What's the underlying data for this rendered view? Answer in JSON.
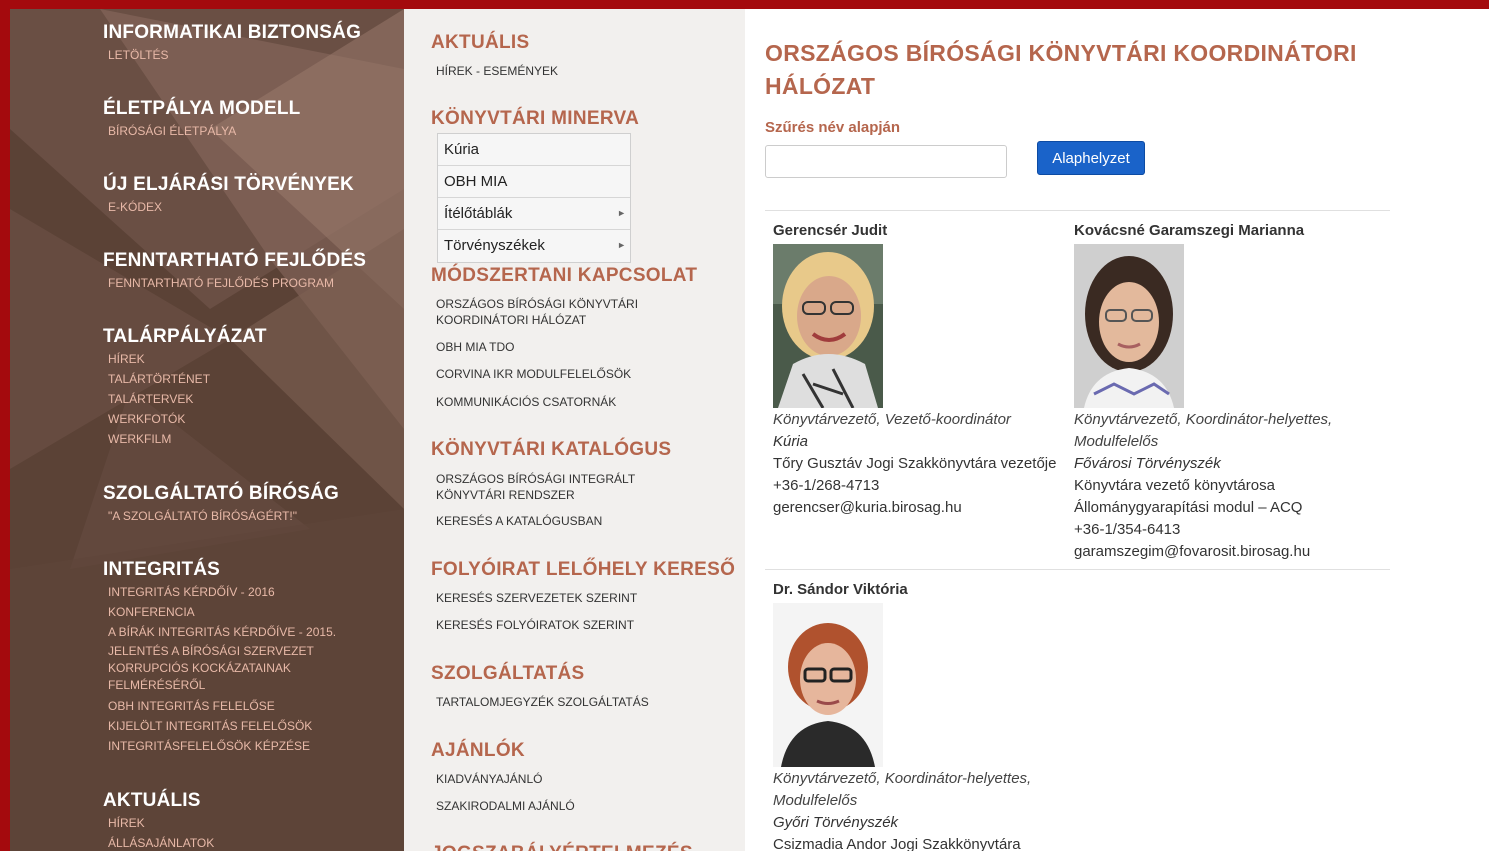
{
  "left_sidebar": {
    "sections": [
      {
        "title": "INFORMATIKAI BIZTONSÁG",
        "links": [
          "LETÖLTÉS"
        ]
      },
      {
        "title": "ÉLETPÁLYA MODELL",
        "links": [
          "BÍRÓSÁGI ÉLETPÁLYA"
        ]
      },
      {
        "title": "ÚJ ELJÁRÁSI TÖRVÉNYEK",
        "links": [
          "E-KÓDEX"
        ]
      },
      {
        "title": "FENNTARTHATÓ FEJLŐDÉS",
        "links": [
          "FENNTARTHATÓ FEJLŐDÉS PROGRAM"
        ]
      },
      {
        "title": "TALÁRPÁLYÁZAT",
        "links": [
          "HÍREK",
          "TALÁRTÖRTÉNET",
          "TALÁRTERVEK",
          "WERKFOTÓK",
          "WERKFILM"
        ]
      },
      {
        "title": "SZOLGÁLTATÓ BÍRÓSÁG",
        "links": [
          "\"A SZOLGÁLTATÓ BÍRÓSÁGÉRT!\""
        ]
      },
      {
        "title": "INTEGRITÁS",
        "links": [
          "INTEGRITÁS KÉRDŐÍV - 2016",
          "KONFERENCIA",
          "A BÍRÁK INTEGRITÁS KÉRDŐÍVE - 2015.",
          "JELENTÉS A BÍRÓSÁGI SZERVEZET KORRUPCIÓS KOCKÁZATAINAK FELMÉRÉSÉRŐL",
          "OBH INTEGRITÁS FELELŐSE",
          "KIJELÖLT INTEGRITÁS FELELŐSÖK",
          "INTEGRITÁSFELELŐSÖK KÉPZÉSE"
        ]
      },
      {
        "title": "AKTUÁLIS",
        "links": [
          "HÍREK",
          "ÁLLÁSAJÁNLATOK"
        ]
      }
    ]
  },
  "middle": {
    "aktualis": {
      "heading": "AKTUÁLIS",
      "links": [
        "HÍREK - ESEMÉNYEK"
      ]
    },
    "minerva": {
      "heading": "KÖNYVTÁRI MINERVA",
      "menu": [
        "Kúria",
        "OBH MIA",
        "Ítélőtáblák",
        "Törvényszékek"
      ],
      "arrow": "►"
    },
    "modszertani": {
      "heading": "MÓDSZERTANI KAPCSOLAT",
      "links": [
        "ORSZÁGOS BÍRÓSÁGI KÖNYVTÁRI KOORDINÁTORI HÁLÓZAT",
        "OBH MIA TDO",
        "CORVINA IKR MODULFELELŐSÖK",
        "KOMMUNIKÁCIÓS CSATORNÁK"
      ]
    },
    "katalogus": {
      "heading": "KÖNYVTÁRI KATALÓGUS",
      "links": [
        "ORSZÁGOS BÍRÓSÁGI INTEGRÁLT KÖNYVTÁRI RENDSZER",
        "KERESÉS A KATALÓGUSBAN"
      ]
    },
    "folyoirat": {
      "heading": "FOLYÓIRAT LELŐHELY KERESŐ",
      "links": [
        "KERESÉS SZERVEZETEK SZERINT",
        "KERESÉS FOLYÓIRATOK SZERINT"
      ]
    },
    "szolgaltatas": {
      "heading": "SZOLGÁLTATÁS",
      "links": [
        "TARTALOMJEGYZÉK SZOLGÁLTATÁS"
      ]
    },
    "ajanlok": {
      "heading": "AJÁNLÓK",
      "links": [
        "KIADVÁNYAJÁNLÓ",
        "SZAKIRODALMI AJÁNLÓ"
      ]
    },
    "next_heading": "JOGSZABÁLYÉRTELMEZÉS"
  },
  "main": {
    "title": "ORSZÁGOS BÍRÓSÁGI KÖNYVTÁRI KOORDINÁTORI HÁLÓZAT",
    "filter": {
      "label": "Szűrés név alapján",
      "value": "",
      "placeholder": ""
    },
    "reset_label": "Alaphelyzet",
    "people": [
      {
        "name": "Gerencsér Judit",
        "role": "Könyvtárvezető, Vezető-koordinátor",
        "institution": "Kúria",
        "lines": [
          "Tőry Gusztáv Jogi Szakkönyvtára vezetője",
          "+36-1/268-4713",
          "gerencser@kuria.birosag.hu"
        ]
      },
      {
        "name": "Kovácsné Garamszegi Marianna",
        "role": "Könyvtárvezető, Koordinátor-helyettes, Modulfelelős",
        "institution": "Fővárosi Törvényszék",
        "lines": [
          "Könyvtára vezető könyvtárosa",
          "Állománygyarapítási modul – ACQ",
          "+36-1/354-6413",
          "garamszegim@fovarosit.birosag.hu"
        ]
      },
      {
        "name": "Dr. Sándor Viktória",
        "role": "Könyvtárvezető, Koordinátor-helyettes, Modulfelelős",
        "institution": "Győri Törvényszék",
        "lines": [
          "Csizmadia Andor Jogi Szakkönyvtára"
        ]
      }
    ]
  },
  "colors": {
    "accent": "#b5664d",
    "frame": "#a40a0d",
    "sidebar": "#5a4338",
    "button": "#1a63c9"
  }
}
